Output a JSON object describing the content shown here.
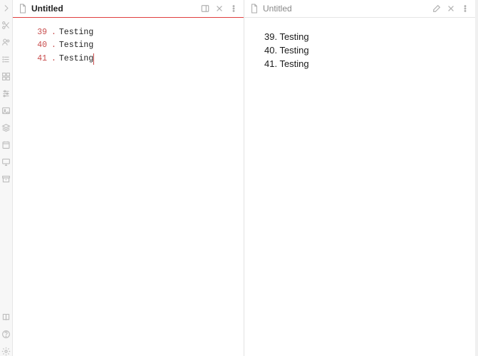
{
  "sidebar": {
    "top_icons": [
      "chevron-right",
      "scissors",
      "users",
      "list",
      "grid",
      "sliders",
      "image",
      "layers",
      "calendar",
      "monitor",
      "archive"
    ],
    "bottom_icons": [
      "book",
      "help",
      "settings"
    ]
  },
  "left_pane": {
    "title": "Untitled",
    "action_icons": [
      "panel-toggle",
      "close",
      "more"
    ],
    "lines": [
      {
        "n": "39",
        "text": "Testing"
      },
      {
        "n": "40",
        "text": "Testing"
      },
      {
        "n": "41",
        "text": "Testing"
      }
    ],
    "cursor_line": 2
  },
  "right_pane": {
    "title": "Untitled",
    "action_icons": [
      "edit",
      "close",
      "more"
    ],
    "lines": [
      {
        "n": "39",
        "text": "Testing"
      },
      {
        "n": "40",
        "text": "Testing"
      },
      {
        "n": "41",
        "text": "Testing"
      }
    ]
  }
}
